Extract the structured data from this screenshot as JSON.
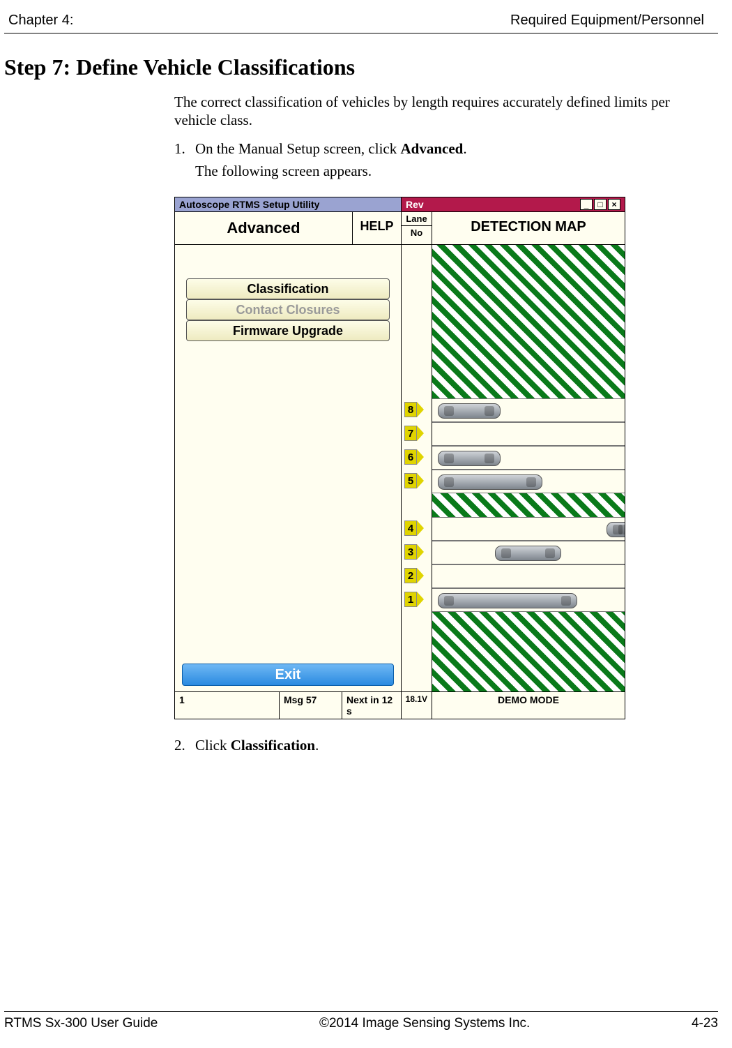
{
  "header": {
    "left": "Chapter 4:",
    "right": "Required Equipment/Personnel"
  },
  "title": "Step 7:  Define Vehicle Classifications",
  "intro": "The correct classification of vehicles by length requires accurately defined limits per vehicle class.",
  "steps": {
    "s1_num": "1.",
    "s1_a": "On the Manual Setup screen, click ",
    "s1_b": "Advanced",
    "s1_c": ".",
    "s1_sub": "The following screen appears.",
    "s2_num": "2.",
    "s2_a": "Click ",
    "s2_b": "Classification",
    "s2_c": "."
  },
  "app": {
    "title_left": "Autoscope RTMS Setup Utility",
    "title_right": "Rev",
    "advanced": "Advanced",
    "help": "HELP",
    "lane": "Lane",
    "no": "No",
    "detmap": "DETECTION MAP",
    "btn_classification": "Classification",
    "btn_contact": "Contact Closures",
    "btn_firmware": "Firmware Upgrade",
    "btn_exit": "Exit",
    "lanes": {
      "l8": "8",
      "l7": "7",
      "l6": "6",
      "l5": "5",
      "l4": "4",
      "l3": "3",
      "l2": "2",
      "l1": "1"
    },
    "status": {
      "s1": "1",
      "s2": "Msg 57",
      "s3": "Next in 12 s",
      "s4": "18.1V",
      "s5": "DEMO MODE"
    },
    "win": {
      "min": "_",
      "max": "□",
      "close": "×"
    }
  },
  "footer": {
    "left": "RTMS Sx-300 User Guide",
    "mid": "©2014 Image Sensing Systems Inc.",
    "right": "4-23"
  }
}
